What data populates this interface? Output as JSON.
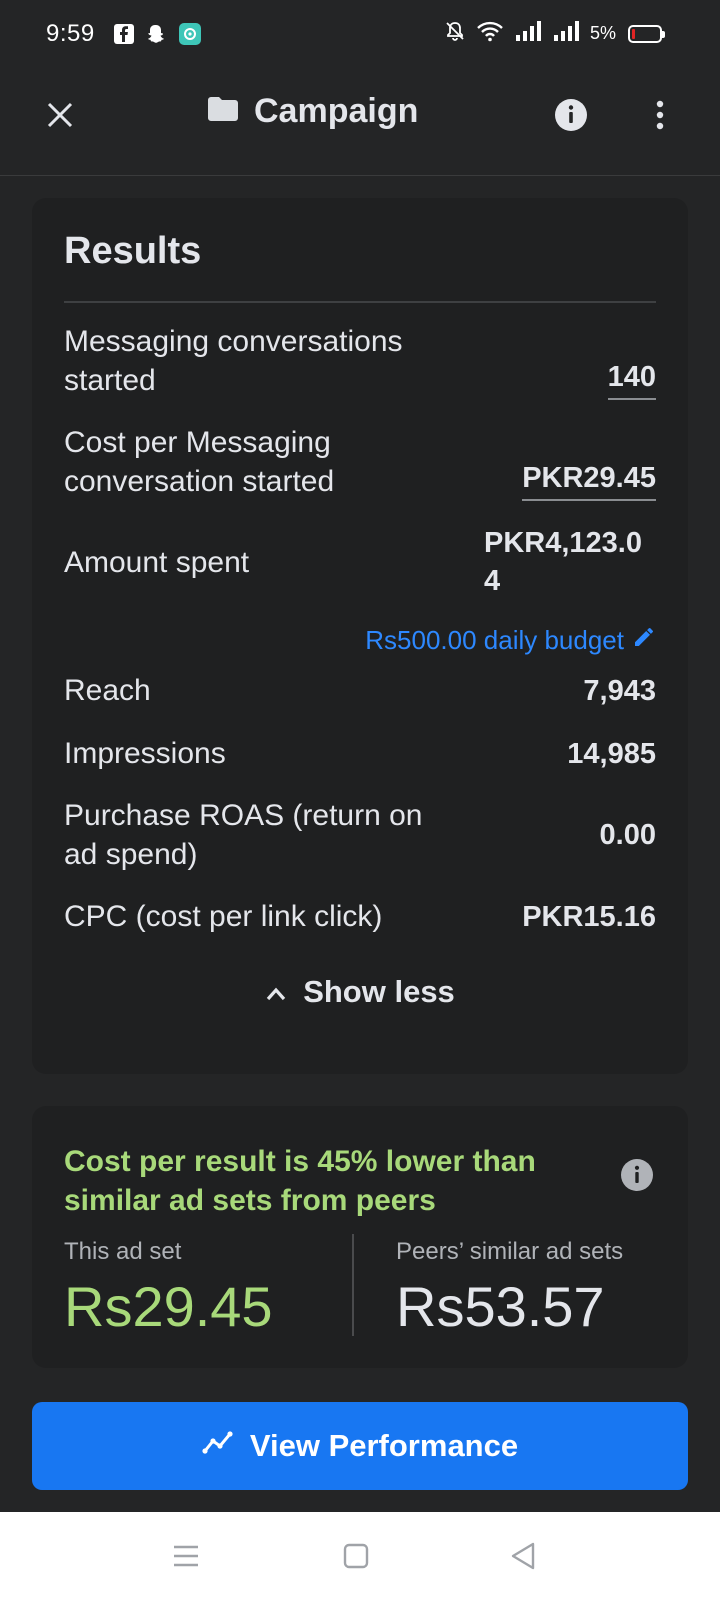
{
  "status_bar": {
    "time": "9:59",
    "battery_percent": "5%",
    "left_icons": [
      "facebook-icon",
      "snapchat-icon",
      "app-icon"
    ],
    "right_icons": [
      "bell-off-icon",
      "wifi-icon",
      "signal-icon",
      "signal-icon",
      "battery-icon"
    ]
  },
  "app_bar": {
    "title": "Campaign",
    "folder_icon": "folder-icon"
  },
  "results": {
    "title": "Results",
    "metrics": [
      {
        "label": "Messaging conversations started",
        "value": "140"
      },
      {
        "label": "Cost per Messaging conversation started",
        "value": "PKR29.45"
      },
      {
        "label": "Amount spent",
        "value": "PKR4,123.04"
      },
      {
        "label": "Reach",
        "value": "7,943"
      },
      {
        "label": "Impressions",
        "value": "14,985"
      },
      {
        "label": "Purchase ROAS (return on ad spend)",
        "value": "0.00"
      },
      {
        "label": "CPC (cost per link click)",
        "value": "PKR15.16"
      }
    ],
    "budget_text": "Rs500.00 daily budget",
    "show_less": "Show less"
  },
  "peer_comparison": {
    "title": "Cost per result is 45% lower than similar ad sets from peers",
    "this_label": "This ad set",
    "this_value": "Rs29.45",
    "peers_label": "Peers’ similar ad sets",
    "peers_value": "Rs53.57"
  },
  "view_performance": "View Performance",
  "colors": {
    "background": "#242526",
    "card": "#1f2021",
    "accent_blue": "#1877f2",
    "link_blue": "#2d88ff",
    "positive_green": "#a8d97a"
  }
}
